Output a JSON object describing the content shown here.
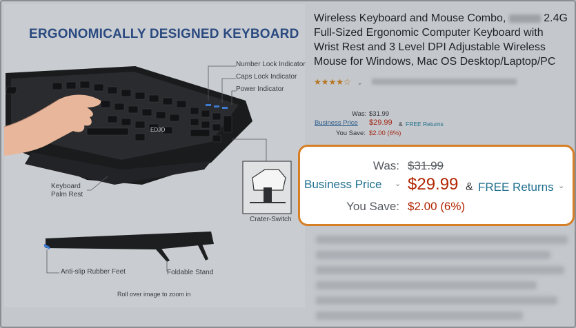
{
  "image": {
    "headline": "ERGONOMICALLY DESIGNED KEYBOARD",
    "callouts": {
      "number_lock": "Number Lock Indicator",
      "caps_lock": "Caps Lock Indicator",
      "power": "Power Indicator",
      "palm_rest_line1": "Keyboard",
      "palm_rest_line2": "Palm Rest",
      "crater_switch": "Crater-Switch",
      "anti_slip": "Anti-slip Rubber Feet",
      "foldable_stand": "Foldable Stand",
      "brand_mark": "EDJO"
    },
    "zoom_hint": "Roll over image to zoom in"
  },
  "product": {
    "title": "Wireless Keyboard and Mouse Combo, 2.4G Full-Sized Ergonomic Computer Keyboard with Wrist Rest and 3 Level DPI Adjustable Wireless Mouse for Windows, Mac OS Desktop/Laptop/PC",
    "title_line1": "Wireless Keyboard and Mouse Combo,",
    "title_rest": "2.4G Full-Sized Ergonomic Computer Keyboard with Wrist Rest and 3 Level DPI Adjustable Wireless Mouse for Windows, Mac OS Desktop/Laptop/PC",
    "stars": "★★★★☆",
    "rating_chevron": "⌄",
    "rating_value": 4.5
  },
  "pricing": {
    "was_label": "Was:",
    "was_value": "$31.99",
    "business_label": "Business Price",
    "chevron": "⌄",
    "price": "$29.99",
    "amp": "&",
    "free_returns": "FREE Returns",
    "save_label": "You Save:",
    "save_value": "$2.00 (6%)"
  },
  "colors": {
    "highlight_border": "#d77f25",
    "price_red": "#b12704",
    "link_teal": "#1f6f8e",
    "headline_blue": "#2a4a80"
  }
}
